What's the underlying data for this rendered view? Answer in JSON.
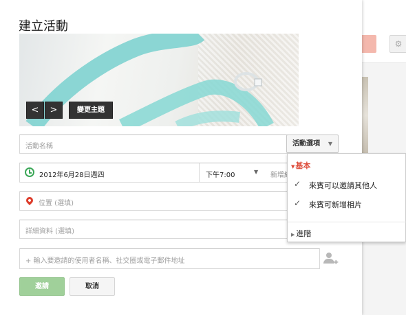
{
  "dialog": {
    "title": "建立活動",
    "banner": {
      "prev_label": "<",
      "next_label": ">",
      "change_theme_label": "變更主題"
    },
    "name_field": {
      "placeholder": "活動名稱"
    },
    "options_button": {
      "label": "活動選項",
      "caret": "▼"
    },
    "date_row": {
      "date": "2012年6月28日週四",
      "time": "下午7:00",
      "time_caret": "▼",
      "add_end_label": "新增結"
    },
    "location_field": {
      "placeholder": "位置 (選填)"
    },
    "details_field": {
      "placeholder": "詳細資料 (選填)"
    },
    "invite_field": {
      "placeholder": "+ 輸入要邀請的使用者名稱、社交圈或電子郵件地址"
    },
    "invite_button": "邀請",
    "cancel_button": "取消"
  },
  "options_menu": {
    "basic_header": "基本",
    "basic_toggle": "▼",
    "items": [
      {
        "check": "✓",
        "label": "來賓可以邀請其他人"
      },
      {
        "check": "✓",
        "label": "來賓可新增相片"
      }
    ],
    "advanced_toggle": "▶",
    "advanced_label": "進階"
  },
  "colors": {
    "accent_red": "#dd4b39",
    "invite_green": "#a0d09a",
    "clock_green": "#3aa757",
    "ribbon": "#7fd3d0"
  },
  "icons": [
    "clock-icon",
    "location-pin-icon",
    "add-guest-icon",
    "checkmark-icon"
  ]
}
